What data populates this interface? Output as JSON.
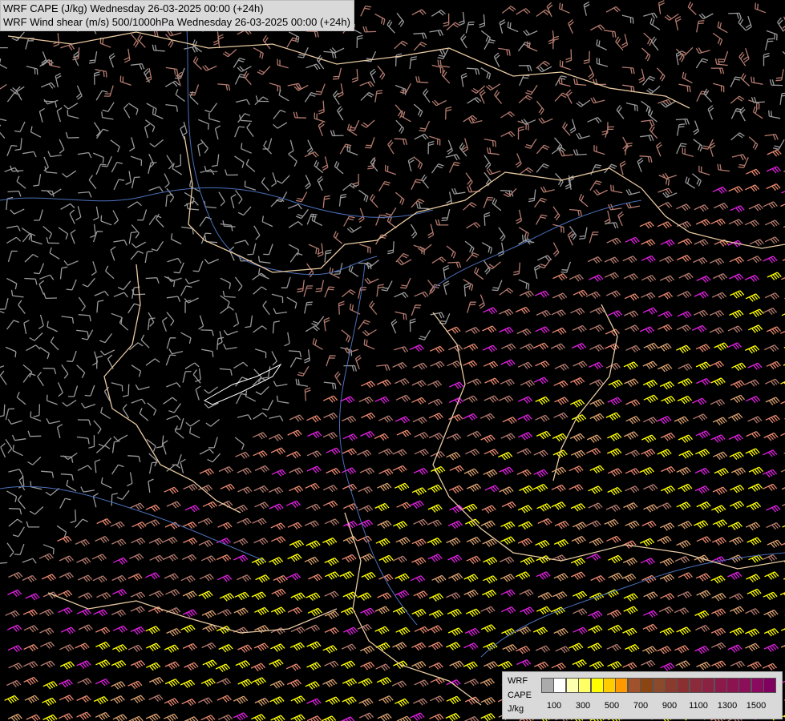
{
  "title": {
    "line1": "WRF CAPE (J/kg) Wednesday 26-03-2025 00:00 (+24h)",
    "line2": "WRF Wind shear (m/s) 500/1000hPa Wednesday 26-03-2025 00:00 (+24h)"
  },
  "legend": {
    "label_line1": "WRF",
    "label_line2": "CAPE",
    "label_unit": "J/kg",
    "swatch_colors": [
      "#ababab",
      "#ffffff",
      "#ffffb0",
      "#ffff66",
      "#ffff00",
      "#ffcc00",
      "#ff9900",
      "#a0522d",
      "#8b4513",
      "#8b4a2b",
      "#8b3a2e",
      "#8b3030",
      "#8b2a3a",
      "#8b2244",
      "#8b1a4a",
      "#8b1450",
      "#8b0e58",
      "#8b0a60",
      "#800060"
    ],
    "ticks": [
      "100",
      "300",
      "500",
      "700",
      "900",
      "1100",
      "1300",
      "1500"
    ]
  },
  "colors": {
    "background": "#000000",
    "border_lines": "#e8c9a0",
    "rivers": "#4a6fb8",
    "barb_low": "#9a9a9a",
    "barb_brown": "#b37a6e",
    "barb_salmon": "#e88870",
    "barb_tan": "#d9a070",
    "barb_yellow": "#ffff00",
    "barb_magenta": "#e020e0"
  }
}
